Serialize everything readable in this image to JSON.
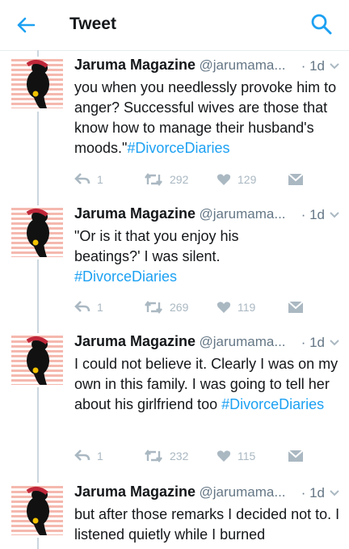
{
  "header": {
    "title": "Tweet",
    "back_icon": "arrow-left-icon",
    "search_icon": "search-icon"
  },
  "colors": {
    "accent": "#1da1f2",
    "muted": "#aab8c2",
    "thread_line": "#ccd6dd",
    "avatar_stripe": "#f5b8ae"
  },
  "tweets": [
    {
      "name": "Jaruma Magazine",
      "handle": "@jarumama...",
      "time": "· 1d",
      "text_before": "you when you needlessly provoke him to anger? Successful wives are those that know how to manage their husband's moods.\"",
      "hashtag": "#DivorceDiaries",
      "text_after": "",
      "replies": "1",
      "retweets": "292",
      "likes": "129"
    },
    {
      "name": "Jaruma Magazine",
      "handle": "@jarumama...",
      "time": "· 1d",
      "text_before": "\"Or is it that you enjoy his beatings?' I was silent. ",
      "hashtag": "#DivorceDiaries",
      "text_after": "",
      "replies": "1",
      "retweets": "269",
      "likes": "119"
    },
    {
      "name": "Jaruma Magazine",
      "handle": "@jarumama...",
      "time": "· 1d",
      "text_before": "I could not believe it. Clearly I was on my own in this family. I was going to tell her about his girlfriend too ",
      "hashtag": "#DivorceDiaries",
      "text_after": "",
      "replies": "1",
      "retweets": "232",
      "likes": "115"
    },
    {
      "name": "Jaruma Magazine",
      "handle": "@jarumama...",
      "time": "· 1d",
      "text_before": "but after those remarks I decided not to. I listened quietly while I burned",
      "hashtag": "",
      "text_after": ""
    }
  ]
}
